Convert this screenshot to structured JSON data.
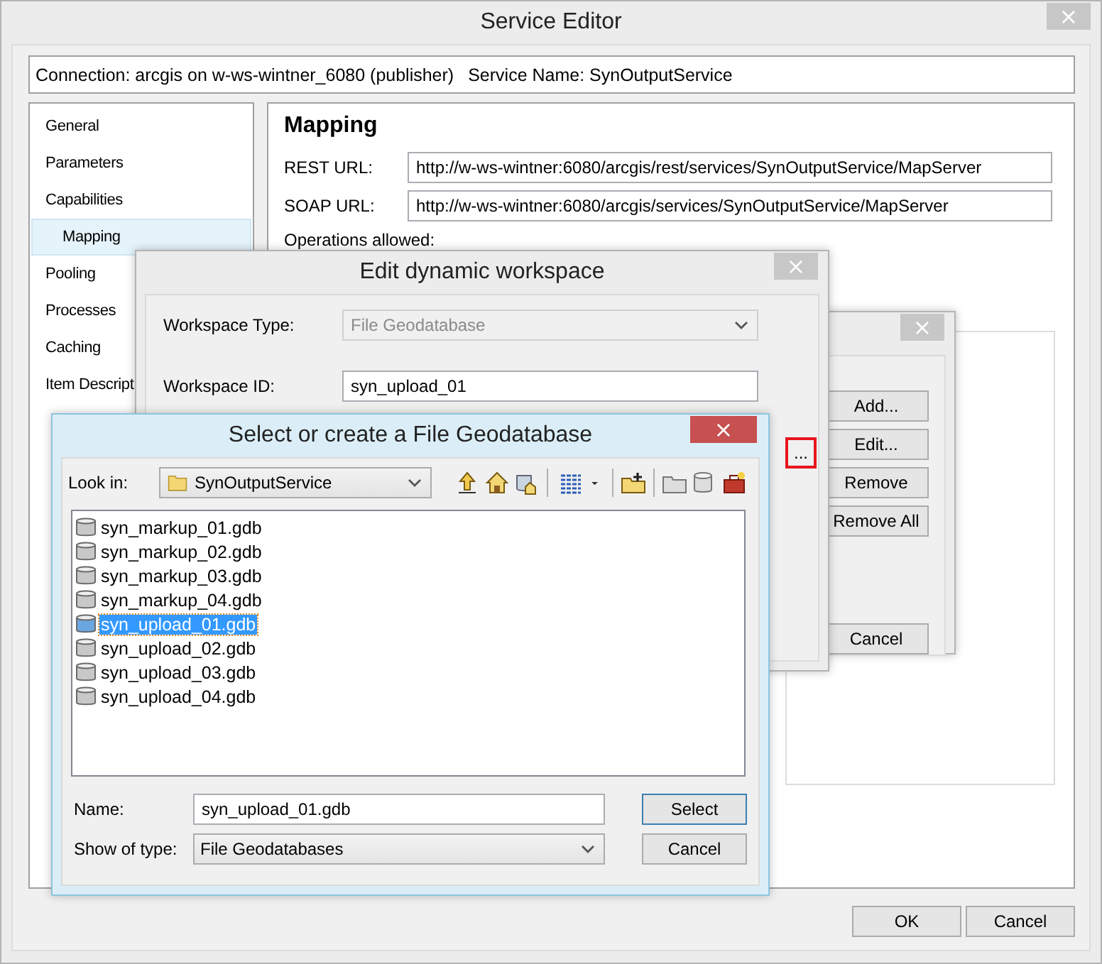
{
  "window": {
    "title": "Service Editor",
    "close": "×"
  },
  "connection_bar": {
    "connection": "Connection: arcgis on w-ws-wintner_6080 (publisher)",
    "service": "Service Name: SynOutputService"
  },
  "sidebar": {
    "items": [
      {
        "label": "General",
        "selected": false
      },
      {
        "label": "Parameters",
        "selected": false
      },
      {
        "label": "Capabilities",
        "selected": false,
        "children": [
          {
            "label": "Mapping",
            "selected": true
          }
        ]
      },
      {
        "label": "Pooling",
        "selected": false
      },
      {
        "label": "Processes",
        "selected": false
      },
      {
        "label": "Caching",
        "selected": false
      },
      {
        "label": "Item Descript",
        "selected": false
      }
    ]
  },
  "panel": {
    "heading": "Mapping",
    "fields": [
      {
        "label": "REST URL:",
        "value": "http://w-ws-wintner:6080/arcgis/rest/services/SynOutputService/MapServer"
      },
      {
        "label": "SOAP URL:",
        "value": "http://w-ws-wintner:6080/arcgis/services/SynOutputService/MapServer"
      }
    ],
    "operations_label": "Operations allowed:"
  },
  "buttons": [
    "OK",
    "Cancel"
  ],
  "background_dialog": {
    "close": "×",
    "buttons": [
      "Add...",
      "Edit...",
      "Remove",
      "Remove All",
      "Cancel"
    ]
  },
  "edit_dialog": {
    "title": "Edit dynamic workspace",
    "close": "×",
    "workspace_type": {
      "label": "Workspace Type:",
      "value": "File Geodatabase",
      "disabled": true
    },
    "workspace_id": {
      "label": "Workspace ID:",
      "value": "syn_upload_01"
    },
    "browse_button": {
      "label": "...",
      "highlighted": true
    }
  },
  "file_dialog": {
    "title": "Select or create a File Geodatabase",
    "close": "×",
    "look_in": {
      "label": "Look in:",
      "value": "SynOutputService"
    },
    "files": [
      {
        "name": "syn_markup_01.gdb",
        "selected": false
      },
      {
        "name": "syn_markup_02.gdb",
        "selected": false
      },
      {
        "name": "syn_markup_03.gdb",
        "selected": false
      },
      {
        "name": "syn_markup_04.gdb",
        "selected": false
      },
      {
        "name": "syn_upload_01.gdb",
        "selected": true
      },
      {
        "name": "syn_upload_02.gdb",
        "selected": false
      },
      {
        "name": "syn_upload_03.gdb",
        "selected": false
      },
      {
        "name": "syn_upload_04.gdb",
        "selected": false
      }
    ],
    "name": {
      "label": "Name:",
      "value": "syn_upload_01.gdb"
    },
    "type": {
      "label": "Show of type:",
      "value": "File Geodatabases"
    },
    "buttons": [
      {
        "label": "Select",
        "default": true
      },
      {
        "label": "Cancel",
        "default": false
      }
    ]
  }
}
